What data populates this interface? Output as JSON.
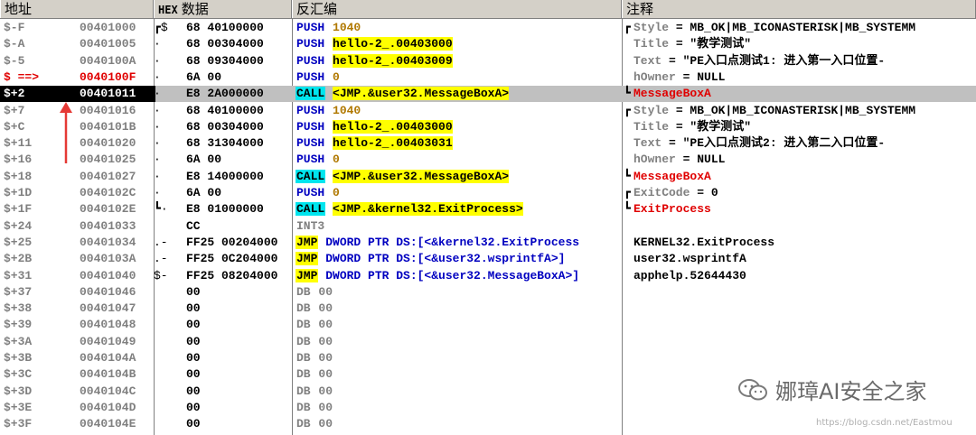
{
  "header": {
    "address": "地址",
    "hex_tag": "HEX",
    "hex_label": "数据",
    "disasm": "反汇编",
    "comment": "注释"
  },
  "rows": [
    {
      "label": "$-F",
      "addr": "00401000",
      "br": "┏$",
      "hex": "68 40100000",
      "mn": "PUSH",
      "mc": "push",
      "op": "1040",
      "oc": "olive",
      "cb": "┏",
      "cn": "Style",
      "cv": " = MB_OK|MB_ICONASTERISK|MB_SYSTEMM",
      "cc": "n"
    },
    {
      "label": "$-A",
      "addr": "00401005",
      "br": "·",
      "hex": "68 00304000",
      "mn": "PUSH",
      "mc": "push",
      "op": "hello-2_.00403000",
      "oc": "yellow",
      "cb": "",
      "cn": "Title",
      "cv": " = \"教学测试\"",
      "cc": "n"
    },
    {
      "label": "$-5",
      "addr": "0040100A",
      "br": "·",
      "hex": "68 09304000",
      "mn": "PUSH",
      "mc": "push",
      "op": "hello-2_.00403009",
      "oc": "yellow",
      "cb": "",
      "cn": "Text",
      "cv": " = \"PE入口点测试1: 进入第一入口位置-",
      "cc": "n"
    },
    {
      "label": "$ ==>",
      "addr": "0040100F",
      "br": "·",
      "hex": "6A 00",
      "mn": "PUSH",
      "mc": "push",
      "op": "0",
      "oc": "olive",
      "cb": "",
      "cn": "hOwner",
      "cv": " = NULL",
      "cc": "n",
      "cur": true
    },
    {
      "label": "$+2",
      "addr": "00401011",
      "br": "·",
      "hex": "E8 2A000000",
      "mn": "CALL",
      "mc": "call",
      "op": "<JMP.&user32.MessageBoxA>",
      "oc": "yellow",
      "cb": "┗",
      "cn": "",
      "cv": "MessageBoxA",
      "cc": "red",
      "sel": true
    },
    {
      "label": "$+7",
      "addr": "00401016",
      "br": "·",
      "hex": "68 40100000",
      "mn": "PUSH",
      "mc": "push",
      "op": "1040",
      "oc": "olive",
      "cb": "┏",
      "cn": "Style",
      "cv": " = MB_OK|MB_ICONASTERISK|MB_SYSTEMM",
      "cc": "n"
    },
    {
      "label": "$+C",
      "addr": "0040101B",
      "br": "·",
      "hex": "68 00304000",
      "mn": "PUSH",
      "mc": "push",
      "op": "hello-2_.00403000",
      "oc": "yellow",
      "cb": "",
      "cn": "Title",
      "cv": " = \"教学测试\"",
      "cc": "n"
    },
    {
      "label": "$+11",
      "addr": "00401020",
      "br": "·",
      "hex": "68 31304000",
      "mn": "PUSH",
      "mc": "push",
      "op": "hello-2_.00403031",
      "oc": "yellow",
      "cb": "",
      "cn": "Text",
      "cv": " = \"PE入口点测试2: 进入第二入口位置-",
      "cc": "n"
    },
    {
      "label": "$+16",
      "addr": "00401025",
      "br": "·",
      "hex": "6A 00",
      "mn": "PUSH",
      "mc": "push",
      "op": "0",
      "oc": "olive",
      "cb": "",
      "cn": "hOwner",
      "cv": " = NULL",
      "cc": "n"
    },
    {
      "label": "$+18",
      "addr": "00401027",
      "br": "·",
      "hex": "E8 14000000",
      "mn": "CALL",
      "mc": "call",
      "op": "<JMP.&user32.MessageBoxA>",
      "oc": "yellow",
      "cb": "┗",
      "cn": "",
      "cv": "MessageBoxA",
      "cc": "red"
    },
    {
      "label": "$+1D",
      "addr": "0040102C",
      "br": "·",
      "hex": "6A 00",
      "mn": "PUSH",
      "mc": "push",
      "op": "0",
      "oc": "olive",
      "cb": "┏",
      "cn": "ExitCode",
      "cv": " = 0",
      "cc": "n"
    },
    {
      "label": "$+1F",
      "addr": "0040102E",
      "br": "┗·",
      "hex": "E8 01000000",
      "mn": "CALL",
      "mc": "call",
      "op": "<JMP.&kernel32.ExitProcess>",
      "oc": "yellow",
      "cb": "┗",
      "cn": "",
      "cv": "ExitProcess",
      "cc": "red"
    },
    {
      "label": "$+24",
      "addr": "00401033",
      "br": "",
      "hex": "CC",
      "mn": "INT3",
      "mc": "int3",
      "op": "",
      "oc": "none",
      "cb": "",
      "cn": "",
      "cv": "",
      "cc": "n"
    },
    {
      "label": "$+25",
      "addr": "00401034",
      "br": ".-",
      "hex": "FF25 00204000",
      "mn": "JMP",
      "mc": "jmp",
      "op": "DWORD PTR DS:[<&kernel32.ExitProcess",
      "oc": "blue",
      "cb": "",
      "cn": "",
      "cv": "KERNEL32.ExitProcess",
      "cc": "n"
    },
    {
      "label": "$+2B",
      "addr": "0040103A",
      "br": ".-",
      "hex": "FF25 0C204000",
      "mn": "JMP",
      "mc": "jmp",
      "op": "DWORD PTR DS:[<&user32.wsprintfA>]",
      "oc": "blue",
      "cb": "",
      "cn": "",
      "cv": "user32.wsprintfA",
      "cc": "n"
    },
    {
      "label": "$+31",
      "addr": "00401040",
      "br": "$-",
      "hex": "FF25 08204000",
      "mn": "JMP",
      "mc": "jmp",
      "op": "DWORD PTR DS:[<&user32.MessageBoxA>]",
      "oc": "blue",
      "cb": "",
      "cn": "",
      "cv": "apphelp.52644430",
      "cc": "n"
    },
    {
      "label": "$+37",
      "addr": "00401046",
      "br": "",
      "hex": "00",
      "mn": "DB",
      "mc": "db",
      "op": "00",
      "oc": "grey",
      "cb": "",
      "cn": "",
      "cv": "",
      "cc": "n"
    },
    {
      "label": "$+38",
      "addr": "00401047",
      "br": "",
      "hex": "00",
      "mn": "DB",
      "mc": "db",
      "op": "00",
      "oc": "grey",
      "cb": "",
      "cn": "",
      "cv": "",
      "cc": "n"
    },
    {
      "label": "$+39",
      "addr": "00401048",
      "br": "",
      "hex": "00",
      "mn": "DB",
      "mc": "db",
      "op": "00",
      "oc": "grey",
      "cb": "",
      "cn": "",
      "cv": "",
      "cc": "n"
    },
    {
      "label": "$+3A",
      "addr": "00401049",
      "br": "",
      "hex": "00",
      "mn": "DB",
      "mc": "db",
      "op": "00",
      "oc": "grey",
      "cb": "",
      "cn": "",
      "cv": "",
      "cc": "n"
    },
    {
      "label": "$+3B",
      "addr": "0040104A",
      "br": "",
      "hex": "00",
      "mn": "DB",
      "mc": "db",
      "op": "00",
      "oc": "grey",
      "cb": "",
      "cn": "",
      "cv": "",
      "cc": "n"
    },
    {
      "label": "$+3C",
      "addr": "0040104B",
      "br": "",
      "hex": "00",
      "mn": "DB",
      "mc": "db",
      "op": "00",
      "oc": "grey",
      "cb": "",
      "cn": "",
      "cv": "",
      "cc": "n"
    },
    {
      "label": "$+3D",
      "addr": "0040104C",
      "br": "",
      "hex": "00",
      "mn": "DB",
      "mc": "db",
      "op": "00",
      "oc": "grey",
      "cb": "",
      "cn": "",
      "cv": "",
      "cc": "n"
    },
    {
      "label": "$+3E",
      "addr": "0040104D",
      "br": "",
      "hex": "00",
      "mn": "DB",
      "mc": "db",
      "op": "00",
      "oc": "grey",
      "cb": "",
      "cn": "",
      "cv": "",
      "cc": "n"
    },
    {
      "label": "$+3F",
      "addr": "0040104E",
      "br": "",
      "hex": "00",
      "mn": "DB",
      "mc": "db",
      "op": "00",
      "oc": "grey",
      "cb": "",
      "cn": "",
      "cv": "",
      "cc": "n"
    }
  ],
  "watermark": {
    "text": "娜璋AI安全之家",
    "url": "https://blog.csdn.net/Eastmou"
  },
  "colors": {
    "selected_row": "#c0c0c0",
    "call_highlight": "#00e5ee",
    "jmp_highlight": "#ffff00",
    "arrow": "#e53935",
    "current_eip": "#e00000"
  }
}
